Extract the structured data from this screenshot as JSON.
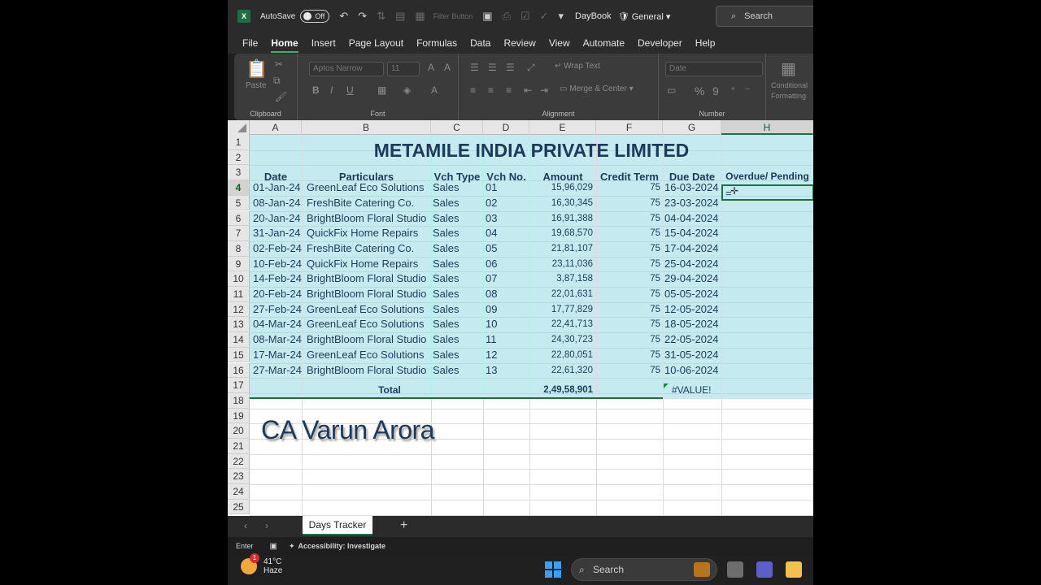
{
  "titlebar": {
    "autosave_label": "AutoSave",
    "autosave_state": "Off",
    "filter_button": "Filter Button",
    "doc_name": "DayBook",
    "sensitivity": "General",
    "search_label": "Search"
  },
  "menu": [
    "File",
    "Home",
    "Insert",
    "Page Layout",
    "Formulas",
    "Data",
    "Review",
    "View",
    "Automate",
    "Developer",
    "Help"
  ],
  "ribbon": {
    "clipboard": {
      "label": "Clipboard",
      "paste": "Paste"
    },
    "font": {
      "label": "Font",
      "name": "Aptos Narrow",
      "size": "11"
    },
    "alignment": {
      "label": "Alignment",
      "wrap": "Wrap Text",
      "merge": "Merge & Center"
    },
    "number": {
      "label": "Number",
      "format": "Date"
    },
    "styles": {
      "conditional": "Conditional",
      "formatting": "Formatting"
    }
  },
  "columns": [
    "A",
    "B",
    "C",
    "D",
    "E",
    "F",
    "G",
    "H"
  ],
  "rows": [
    "1",
    "2",
    "3",
    "4",
    "5",
    "6",
    "7",
    "8",
    "9",
    "10",
    "11",
    "12",
    "13",
    "14",
    "15",
    "16",
    "17",
    "18",
    "19",
    "20",
    "21",
    "22",
    "23",
    "24",
    "25"
  ],
  "sheet": {
    "title": "METAMILE INDIA PRIVATE LIMITED",
    "headers": [
      "Date",
      "Particulars",
      "Vch Type",
      "Vch No.",
      "Amount",
      "Credit Term",
      "Due Date",
      "Overdue/ Pending"
    ],
    "data": [
      [
        "01-Jan-24",
        "GreenLeaf Eco Solutions",
        "Sales",
        "01",
        "15,96,029",
        "75",
        "16-03-2024"
      ],
      [
        "08-Jan-24",
        "FreshBite Catering Co.",
        "Sales",
        "02",
        "16,30,345",
        "75",
        "23-03-2024"
      ],
      [
        "20-Jan-24",
        "BrightBloom Floral Studio",
        "Sales",
        "03",
        "16,91,388",
        "75",
        "04-04-2024"
      ],
      [
        "31-Jan-24",
        "QuickFix Home Repairs",
        "Sales",
        "04",
        "19,68,570",
        "75",
        "15-04-2024"
      ],
      [
        "02-Feb-24",
        "FreshBite Catering Co.",
        "Sales",
        "05",
        "21,81,107",
        "75",
        "17-04-2024"
      ],
      [
        "10-Feb-24",
        "QuickFix Home Repairs",
        "Sales",
        "06",
        "23,11,036",
        "75",
        "25-04-2024"
      ],
      [
        "14-Feb-24",
        "BrightBloom Floral Studio",
        "Sales",
        "07",
        "3,87,158",
        "75",
        "29-04-2024"
      ],
      [
        "20-Feb-24",
        "BrightBloom Floral Studio",
        "Sales",
        "08",
        "22,01,631",
        "75",
        "05-05-2024"
      ],
      [
        "27-Feb-24",
        "GreenLeaf Eco Solutions",
        "Sales",
        "09",
        "17,77,829",
        "75",
        "12-05-2024"
      ],
      [
        "04-Mar-24",
        "GreenLeaf Eco Solutions",
        "Sales",
        "10",
        "22,41,713",
        "75",
        "18-05-2024"
      ],
      [
        "08-Mar-24",
        "BrightBloom Floral Studio",
        "Sales",
        "11",
        "24,30,723",
        "75",
        "22-05-2024"
      ],
      [
        "17-Mar-24",
        "GreenLeaf Eco Solutions",
        "Sales",
        "12",
        "22,80,051",
        "75",
        "31-05-2024"
      ],
      [
        "27-Mar-24",
        "BrightBloom Floral Studio",
        "Sales",
        "13",
        "22,61,320",
        "75",
        "10-06-2024"
      ]
    ],
    "active_cell_value": "=",
    "total_label": "Total",
    "total_amount": "2,49,58,901",
    "total_error": "#VALUE!"
  },
  "watermark": "CA Varun Arora",
  "sheet_tab": "Days Tracker",
  "status": {
    "mode": "Enter",
    "accessibility": "Accessibility: Investigate"
  },
  "taskbar": {
    "temp": "41°C",
    "condition": "Haze",
    "badge": "1",
    "search": "Search"
  }
}
